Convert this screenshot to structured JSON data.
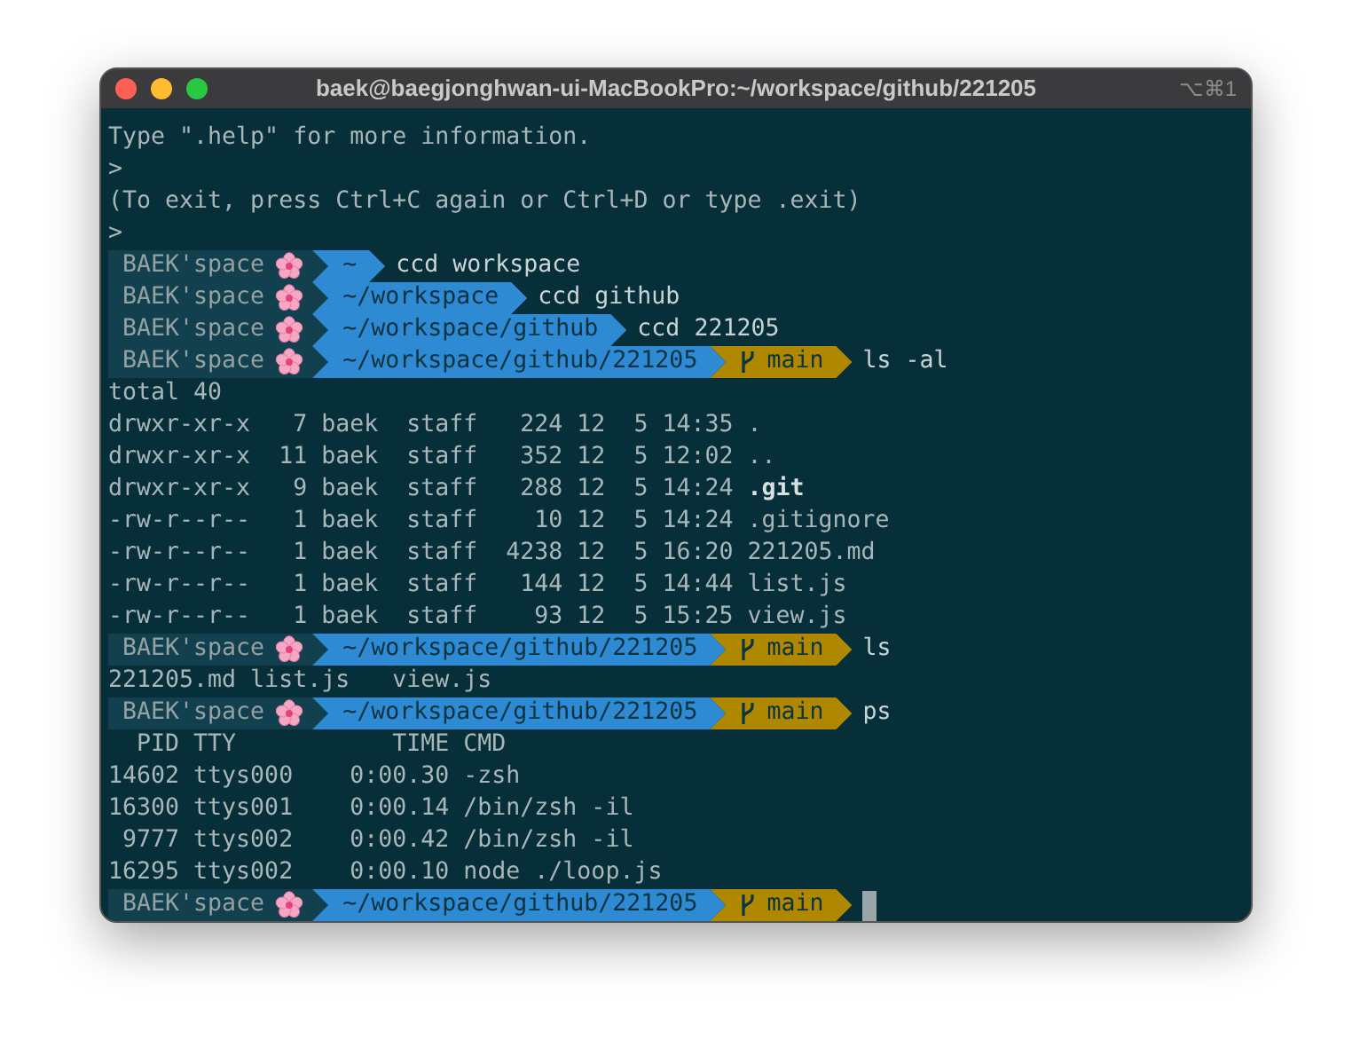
{
  "window": {
    "title": "baek@baegjonghwan-ui-MacBookPro:~/workspace/github/221205",
    "shortcut": "⌥⌘1"
  },
  "lines": [
    {
      "kind": "text",
      "text": "Type \".help\" for more information."
    },
    {
      "kind": "text",
      "text": ">"
    },
    {
      "kind": "text",
      "text": "(To exit, press Ctrl+C again or Ctrl+D or type .exit)"
    },
    {
      "kind": "text",
      "text": ">"
    },
    {
      "kind": "prompt",
      "user": "BAEK'space",
      "path": "~",
      "command": "ccd workspace",
      "cursor": false
    },
    {
      "kind": "prompt",
      "user": "BAEK'space",
      "path": "~/workspace",
      "command": "ccd github",
      "cursor": false
    },
    {
      "kind": "prompt",
      "user": "BAEK'space",
      "path": "~/workspace/github",
      "command": "ccd 221205",
      "cursor": false
    },
    {
      "kind": "prompt",
      "user": "BAEK'space",
      "path": "~/workspace/github/221205",
      "branch": "main",
      "command": "ls -al",
      "cursor": false
    },
    {
      "kind": "text",
      "text": "total 40"
    },
    {
      "kind": "text",
      "text": "drwxr-xr-x   7 baek  staff   224 12  5 14:35 ."
    },
    {
      "kind": "text",
      "text": "drwxr-xr-x  11 baek  staff   352 12  5 12:02 .."
    },
    {
      "kind": "text",
      "text": "drwxr-xr-x   9 baek  staff   288 12  5 14:24 **.git**"
    },
    {
      "kind": "text",
      "text": "-rw-r--r--   1 baek  staff    10 12  5 14:24 .gitignore"
    },
    {
      "kind": "text",
      "text": "-rw-r--r--   1 baek  staff  4238 12  5 16:20 221205.md"
    },
    {
      "kind": "text",
      "text": "-rw-r--r--   1 baek  staff   144 12  5 14:44 list.js"
    },
    {
      "kind": "text",
      "text": "-rw-r--r--   1 baek  staff    93 12  5 15:25 view.js"
    },
    {
      "kind": "prompt",
      "user": "BAEK'space",
      "path": "~/workspace/github/221205",
      "branch": "main",
      "command": "ls",
      "cursor": false
    },
    {
      "kind": "text",
      "text": "221205.md list.js   view.js"
    },
    {
      "kind": "prompt",
      "user": "BAEK'space",
      "path": "~/workspace/github/221205",
      "branch": "main",
      "command": "ps",
      "cursor": false
    },
    {
      "kind": "text",
      "text": "  PID TTY           TIME CMD"
    },
    {
      "kind": "text",
      "text": "14602 ttys000    0:00.30 -zsh"
    },
    {
      "kind": "text",
      "text": "16300 ttys001    0:00.14 /bin/zsh -il"
    },
    {
      "kind": "text",
      "text": " 9777 ttys002    0:00.42 /bin/zsh -il"
    },
    {
      "kind": "text",
      "text": "16295 ttys002    0:00.10 node ./loop.js"
    },
    {
      "kind": "prompt",
      "user": "BAEK'space",
      "path": "~/workspace/github/221205",
      "branch": "main",
      "cursor": true
    }
  ]
}
